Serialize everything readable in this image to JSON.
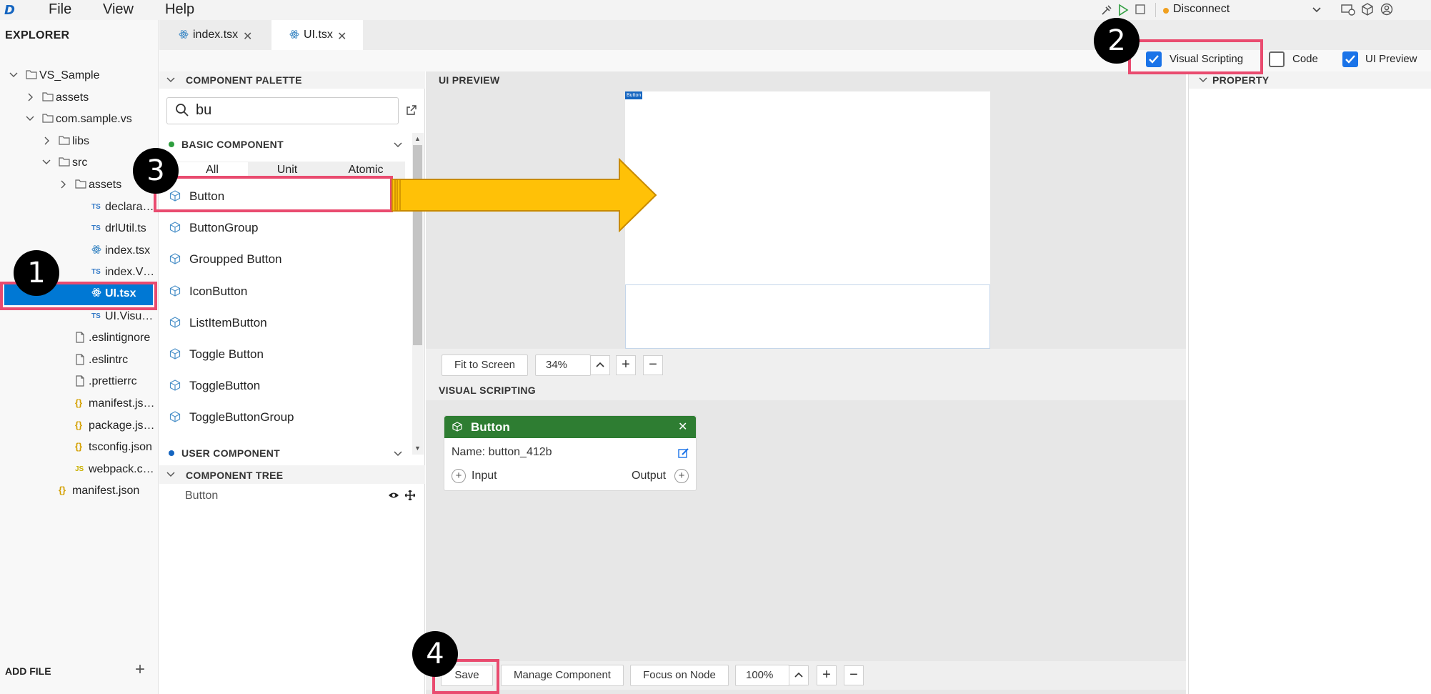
{
  "menu": {
    "items": [
      "File",
      "View",
      "Help"
    ],
    "logo": "D"
  },
  "connection": {
    "label": "Disconnect",
    "status_color": "#f0a020"
  },
  "explorer": {
    "title": "EXPLORER",
    "add_file": "ADD FILE",
    "tree": [
      {
        "label": "VS_Sample",
        "icon": "folder-icon",
        "chevron": "down"
      },
      {
        "label": "assets",
        "icon": "folder-icon",
        "chevron": "right"
      },
      {
        "label": "com.sample.vs",
        "icon": "folder-icon",
        "chevron": "down"
      },
      {
        "label": "libs",
        "icon": "folder-icon",
        "chevron": "right"
      },
      {
        "label": "src",
        "icon": "folder-icon",
        "chevron": "down"
      },
      {
        "label": "assets",
        "icon": "folder-icon",
        "chevron": "right"
      },
      {
        "label": "declaration...",
        "icon": "ts-file-icon"
      },
      {
        "label": "drlUtil.ts",
        "icon": "ts-file-icon"
      },
      {
        "label": "index.tsx",
        "icon": "react-file-icon"
      },
      {
        "label": "index.Visua...",
        "icon": "ts-file-icon"
      },
      {
        "label": "UI.tsx",
        "icon": "react-file-icon",
        "selected": true
      },
      {
        "label": "UI.VisualSc...",
        "icon": "ts-file-icon"
      },
      {
        "label": ".eslintignore",
        "icon": "file-icon"
      },
      {
        "label": ".eslintrc",
        "icon": "file-icon"
      },
      {
        "label": ".prettierrc",
        "icon": "file-icon"
      },
      {
        "label": "manifest.json",
        "icon": "json-file-icon"
      },
      {
        "label": "package.json",
        "icon": "json-file-icon"
      },
      {
        "label": "tsconfig.json",
        "icon": "json-file-icon"
      },
      {
        "label": "webpack.confi...",
        "icon": "js-file-icon"
      },
      {
        "label": "manifest.json",
        "icon": "json-file-icon"
      }
    ]
  },
  "tabs": [
    {
      "label": "index.tsx",
      "active": false
    },
    {
      "label": "UI.tsx",
      "active": true
    }
  ],
  "view_toggles": [
    {
      "label": "Visual Scripting",
      "checked": true
    },
    {
      "label": "Code",
      "checked": false
    },
    {
      "label": "UI Preview",
      "checked": true
    }
  ],
  "palette": {
    "title": "COMPONENT PALETTE",
    "search_value": "bu",
    "basic_title": "BASIC COMPONENT",
    "filters": [
      "All",
      "Unit",
      "Atomic"
    ],
    "items": [
      "Button",
      "ButtonGroup",
      "Groupped Button",
      "IconButton",
      "ListItemButton",
      "Toggle Button",
      "ToggleButton",
      "ToggleButtonGroup"
    ],
    "user_title": "USER COMPONENT"
  },
  "component_tree": {
    "title": "COMPONENT TREE",
    "items": [
      "Button"
    ]
  },
  "ui_preview": {
    "title": "UI PREVIEW",
    "button_tag": "Button",
    "fit_label": "Fit to Screen",
    "zoom": "34%"
  },
  "property": {
    "title": "PROPERTY"
  },
  "visual_scripting": {
    "title": "VISUAL SCRIPTING",
    "node": {
      "title": "Button",
      "name": "Name: button_412b",
      "input": "Input",
      "output": "Output",
      "header_color": "#2e7d32"
    },
    "save": "Save",
    "manage": "Manage Component",
    "focus": "Focus on Node",
    "zoom": "100%"
  },
  "callouts": [
    "1",
    "2",
    "3",
    "4"
  ],
  "colors": {
    "accent": "#1a73e8",
    "highlight": "#e94b6f",
    "arrow": "#ffc107",
    "selection": "#0078d4"
  }
}
